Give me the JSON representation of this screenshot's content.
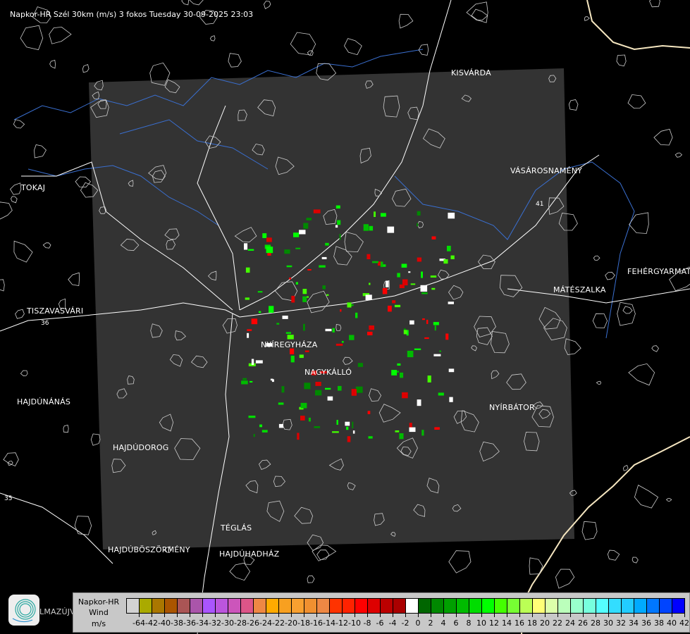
{
  "title": "Napkor-HR Szél 30km (m/s) 3 fokos Tuesday 30-09-2025 23:03",
  "cities": [
    {
      "name": "KISVÁRDA"
    },
    {
      "name": "VÁSÁROSNAMÉNY"
    },
    {
      "name": "TOKAJ"
    },
    {
      "name": "TISZAVASVÁRI"
    },
    {
      "name": "NYÍREGYHÁZA"
    },
    {
      "name": "NAGYKÁLLÓ"
    },
    {
      "name": "MÁTÉSZALKA"
    },
    {
      "name": "FEHÉRGYARMAT"
    },
    {
      "name": "NYÍRBÁTOR"
    },
    {
      "name": "HAJDÚNÁNÁS"
    },
    {
      "name": "HAJDÚDOROG"
    },
    {
      "name": "TÉGLÁS"
    },
    {
      "name": "HAJDÚBÖSZÖRMÉNY"
    },
    {
      "name": "HAJDÚHADHÁZ"
    },
    {
      "name": "LMAZÚJVÁROS"
    }
  ],
  "roads": [
    "36",
    "35",
    "41"
  ],
  "colors": {
    "radar_area": "#333333",
    "roads": "#ffffff",
    "rivers": "#3a6fd0",
    "border": "#f5e6c0"
  },
  "legend": {
    "line1": "Napkor-HR",
    "line2": "Wind",
    "line3": "m/s",
    "ticks": [
      "-64",
      "-42",
      "-40",
      "-38",
      "-36",
      "-34",
      "-32",
      "-30",
      "-28",
      "-26",
      "-24",
      "-22",
      "-20",
      "-18",
      "-16",
      "-14",
      "-12",
      "-10",
      "-8",
      "-6",
      "-4",
      "-2",
      "0",
      "2",
      "4",
      "6",
      "8",
      "10",
      "12",
      "14",
      "16",
      "18",
      "20",
      "22",
      "24",
      "26",
      "28",
      "30",
      "32",
      "34",
      "36",
      "38",
      "40",
      "42"
    ],
    "colors": [
      "#d3d3d3",
      "#aaaa00",
      "#aa7700",
      "#aa5500",
      "#aa5555",
      "#aa55aa",
      "#aa55ff",
      "#bb55dd",
      "#cc55bb",
      "#dd5588",
      "#ee8844",
      "#ffaa00",
      "#f8a020",
      "#f8a030",
      "#f09030",
      "#ee8844",
      "#ff3300",
      "#ff2200",
      "#ff0000",
      "#dd0000",
      "#bb0000",
      "#aa0000",
      "#ffffff",
      "#006600",
      "#008800",
      "#00a000",
      "#00bb00",
      "#00dd00",
      "#00ff00",
      "#44ff00",
      "#77ff33",
      "#bbff55",
      "#ffff77",
      "#ddffaa",
      "#bbffbb",
      "#99ffcc",
      "#77ffdd",
      "#55ffff",
      "#33ddff",
      "#22ccff",
      "#00aaff",
      "#0077ff",
      "#0044ff",
      "#0000ff"
    ]
  }
}
